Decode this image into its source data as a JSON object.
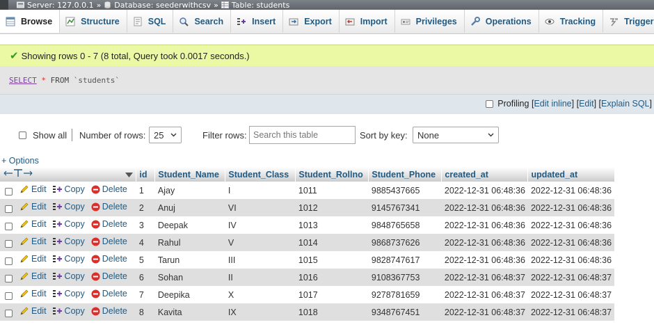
{
  "breadcrumb": {
    "server": "Server: 127.0.0.1",
    "database": "Database: seederwithcsv",
    "table": "Table: students",
    "sep": "»"
  },
  "tabs": [
    {
      "label": "Browse",
      "icon": "browse-icon"
    },
    {
      "label": "Structure",
      "icon": "structure-icon"
    },
    {
      "label": "SQL",
      "icon": "sql-icon"
    },
    {
      "label": "Search",
      "icon": "search-icon"
    },
    {
      "label": "Insert",
      "icon": "insert-icon"
    },
    {
      "label": "Export",
      "icon": "export-icon"
    },
    {
      "label": "Import",
      "icon": "import-icon"
    },
    {
      "label": "Privileges",
      "icon": "privileges-icon"
    },
    {
      "label": "Operations",
      "icon": "wrench-icon"
    },
    {
      "label": "Tracking",
      "icon": "eye-icon"
    },
    {
      "label": "Triggers",
      "icon": "triggers-icon"
    }
  ],
  "message": "Showing rows 0 - 7 (8 total, Query took 0.0017 seconds.)",
  "query": {
    "select": "SELECT",
    "star": "*",
    "from": "FROM",
    "table": "`students`"
  },
  "profiling": {
    "label": "Profiling",
    "bracket_open": "[",
    "bracket_close": "]",
    "sep": "] [",
    "edit_inline": "Edit inline",
    "edit": "Edit",
    "explain": "Explain SQL"
  },
  "nav": {
    "show_all": "Show all",
    "rows_label": "Number of rows:",
    "rows_value": "25",
    "filter_label": "Filter rows:",
    "filter_placeholder": "Search this table",
    "sort_label": "Sort by key:",
    "sort_value": "None"
  },
  "options_link": "+ Options",
  "actions": {
    "edit": "Edit",
    "copy": "Copy",
    "delete": "Delete"
  },
  "columns": [
    "id",
    "Student_Name",
    "Student_Class",
    "Student_Rollno",
    "Student_Phone",
    "created_at",
    "updated_at"
  ],
  "rows": [
    [
      "1",
      "Ajay",
      "I",
      "1011",
      "9885437665",
      "2022-12-31 06:48:36",
      "2022-12-31 06:48:36"
    ],
    [
      "2",
      "Anuj",
      "VI",
      "1012",
      "9145767341",
      "2022-12-31 06:48:36",
      "2022-12-31 06:48:36"
    ],
    [
      "3",
      "Deepak",
      "IV",
      "1013",
      "9848765658",
      "2022-12-31 06:48:36",
      "2022-12-31 06:48:36"
    ],
    [
      "4",
      "Rahul",
      "V",
      "1014",
      "9868737626",
      "2022-12-31 06:48:36",
      "2022-12-31 06:48:36"
    ],
    [
      "5",
      "Tarun",
      "III",
      "1015",
      "9828747617",
      "2022-12-31 06:48:36",
      "2022-12-31 06:48:36"
    ],
    [
      "6",
      "Sohan",
      "II",
      "1016",
      "9108367753",
      "2022-12-31 06:48:37",
      "2022-12-31 06:48:37"
    ],
    [
      "7",
      "Deepika",
      "X",
      "1017",
      "9278781659",
      "2022-12-31 06:48:37",
      "2022-12-31 06:48:37"
    ],
    [
      "8",
      "Kavita",
      "IX",
      "1018",
      "9348767451",
      "2022-12-31 06:48:37",
      "2022-12-31 06:48:37"
    ]
  ],
  "colors": {
    "link": "#235a81",
    "success_bg": "#ebf8a4",
    "row_even": "#dfdfdf",
    "delete_red": "#d9302c"
  }
}
